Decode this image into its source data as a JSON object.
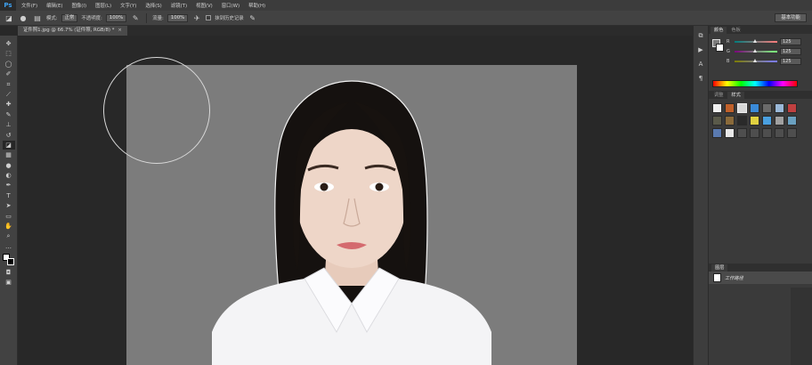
{
  "app": {
    "logo": "Ps"
  },
  "menu": {
    "items": [
      "文件(F)",
      "编辑(E)",
      "图像(I)",
      "图层(L)",
      "文字(Y)",
      "选择(S)",
      "滤镜(T)",
      "视图(V)",
      "窗口(W)",
      "帮助(H)"
    ]
  },
  "options_bar": {
    "mode_label": "模式:",
    "mode_value": "正常",
    "opacity_label": "不透明度:",
    "opacity_value": "100%",
    "flow_label": "流量:",
    "flow_value": "100%",
    "history_label": "抹到历史记录",
    "workspace": "基本功能"
  },
  "document_tab": {
    "title": "证件照1.jpg @ 66.7% (证件照, RGB/8) *",
    "close": "×"
  },
  "panels": {
    "color_tabs": [
      "颜色",
      "色板"
    ],
    "sliders": [
      {
        "channel": "R",
        "value": "125",
        "fraction": 0.49
      },
      {
        "channel": "G",
        "value": "125",
        "fraction": 0.49
      },
      {
        "channel": "B",
        "value": "125",
        "fraction": 0.49
      }
    ],
    "style_tabs": [
      "调整",
      "样式"
    ],
    "layers_title": "图层",
    "layer_name": "工作路径"
  },
  "colors": {
    "foreground": "#ffffff",
    "background": "#000000",
    "canvas_bg": "#7c7c7c",
    "accent": "#3ea1f0"
  },
  "icons": {
    "toolbar": [
      "move-icon",
      "marquee-icon",
      "lasso-icon",
      "quick-select-icon",
      "crop-icon",
      "eyedropper-icon",
      "healing-icon",
      "brush-icon",
      "stamp-icon",
      "history-brush-icon",
      "eraser-icon",
      "gradient-icon",
      "blur-icon",
      "dodge-icon",
      "pen-icon",
      "type-icon",
      "path-select-icon",
      "rectangle-icon",
      "hand-icon",
      "zoom-icon"
    ]
  }
}
